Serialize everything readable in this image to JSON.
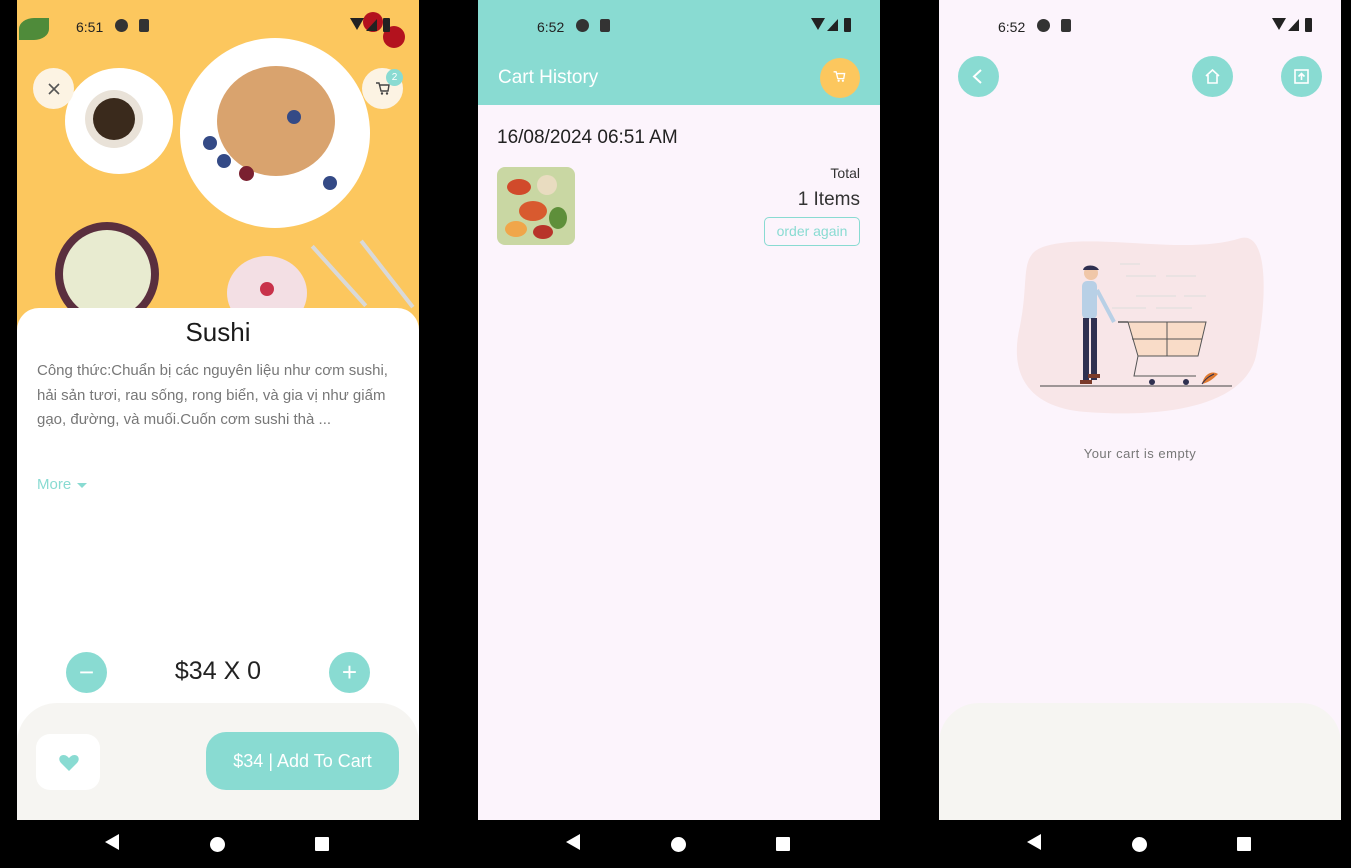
{
  "phone1": {
    "status": {
      "time": "6:51"
    },
    "cart_badge": "2",
    "food": {
      "title": "Sushi",
      "description": "Công thức:Chuẩn bị các nguyên liệu như cơm sushi, hải sản tươi, rau sống, rong biển, và gia vị như giấm gạo, đường, và muối.Cuốn cơm sushi thà ...",
      "more_label": "More"
    },
    "quantity": {
      "decrease": "−",
      "increase": "+",
      "text": "$34 X 0"
    },
    "add_to_cart_label": "$34 | Add To Cart"
  },
  "phone2": {
    "status": {
      "time": "6:52"
    },
    "title": "Cart History",
    "order": {
      "date": "16/08/2024 06:51 AM",
      "total_label": "Total",
      "items": "1 Items",
      "order_again": "order again"
    }
  },
  "phone3": {
    "status": {
      "time": "6:52"
    },
    "empty_text": "Your cart is empty"
  },
  "colors": {
    "accent": "#89dbd2",
    "yellow": "#fcc75e",
    "bg_pink": "#fcf4fc",
    "bottom": "#f6f5f2"
  }
}
